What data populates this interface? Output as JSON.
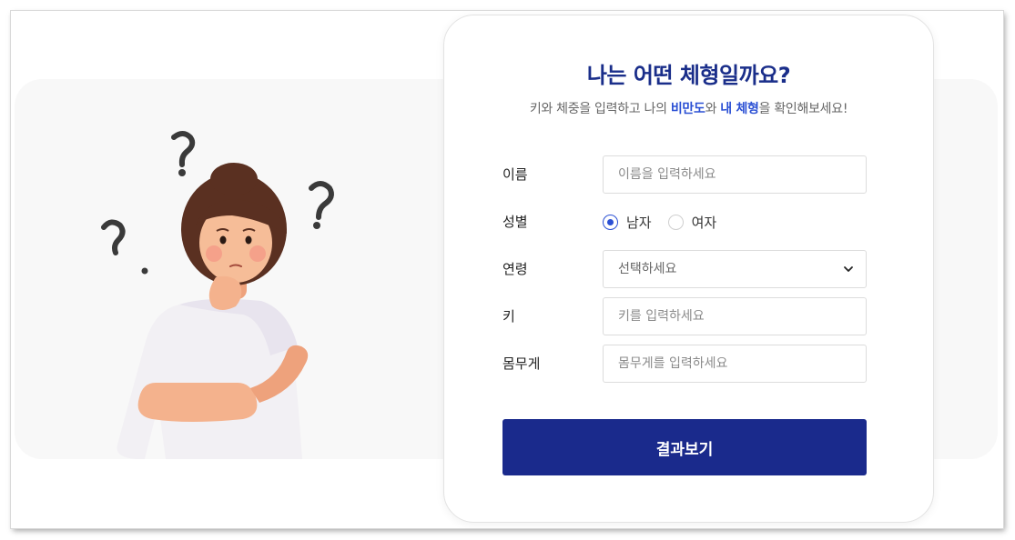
{
  "header": {
    "title": "나는 어떤 체형일까요?",
    "subtitle_pre": "키와 체중을 입력하고 나의 ",
    "subtitle_hl1": "비만도",
    "subtitle_mid": "와 ",
    "subtitle_hl2": "내 체형",
    "subtitle_post": "을 확인해보세요!"
  },
  "form": {
    "name": {
      "label": "이름",
      "placeholder": "이름을 입력하세요",
      "value": ""
    },
    "gender": {
      "label": "성별",
      "options": [
        {
          "label": "남자",
          "checked": true
        },
        {
          "label": "여자",
          "checked": false
        }
      ]
    },
    "age": {
      "label": "연령",
      "selected": "선택하세요"
    },
    "height": {
      "label": "키",
      "placeholder": "키를 입력하세요",
      "value": ""
    },
    "weight": {
      "label": "몸무게",
      "placeholder": "몸무게를 입력하세요",
      "value": ""
    },
    "submit_label": "결과보기"
  },
  "colors": {
    "accent": "#1a2a8c",
    "highlight": "#2b50d4",
    "title": "#1a2e8a",
    "panel_bg": "#f8f8f8"
  },
  "icons": {
    "illustration": "thinking-woman-illustration",
    "question_marks": "question-mark-icon",
    "dropdown": "chevron-down-icon"
  }
}
